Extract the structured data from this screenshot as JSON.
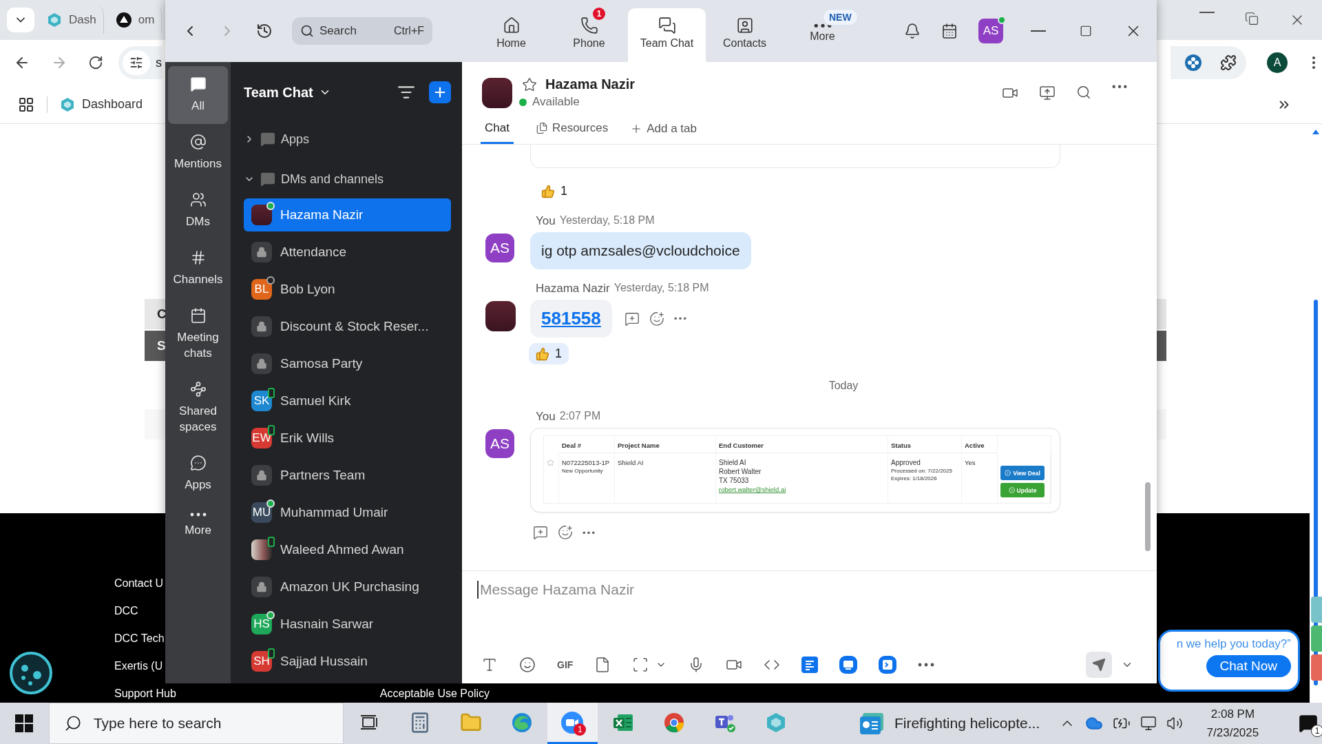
{
  "browser": {
    "tabs": [
      {
        "label": "Dash",
        "selected": false
      },
      {
        "label": "om",
        "selected": false
      }
    ],
    "address": "s",
    "profile": "A",
    "bookmarks": [
      {
        "label": "Dashboard"
      }
    ],
    "page": {
      "blocks": [
        {
          "kind": "light",
          "label": "C"
        },
        {
          "kind": "dark",
          "label": "S"
        },
        {
          "kind": "faint"
        }
      ],
      "footer_links": [
        "Contact U",
        "DCC",
        "DCC Tech",
        "Exertis (U",
        "Support Hub"
      ],
      "policy_link": "Acceptable Use Policy",
      "chat_widget": {
        "prompt": "n we help you today?”",
        "button": "Chat Now"
      }
    }
  },
  "zoom": {
    "search": {
      "placeholder": "Search",
      "shortcut": "Ctrl+F"
    },
    "nav": [
      {
        "label": "Home",
        "selected": false
      },
      {
        "label": "Phone",
        "selected": false,
        "badge": {
          "kind": "count",
          "text": "1"
        }
      },
      {
        "label": "Team Chat",
        "selected": true
      },
      {
        "label": "Contacts",
        "selected": false
      },
      {
        "label": "More",
        "selected": false,
        "badge": {
          "kind": "new",
          "text": "NEW"
        }
      }
    ],
    "profile": {
      "initials": "AS",
      "online": true
    },
    "rail": [
      {
        "label": "All",
        "selected": true
      },
      {
        "label": "Mentions",
        "selected": false
      },
      {
        "label": "DMs",
        "selected": false
      },
      {
        "label": "Channels",
        "selected": false
      },
      {
        "label": "Meeting chats",
        "selected": false
      },
      {
        "label": "Shared spaces",
        "selected": false
      },
      {
        "label": "Apps",
        "selected": false
      },
      {
        "label": "More",
        "selected": false
      }
    ],
    "list": {
      "title": "Team Chat",
      "sections": [
        {
          "label": "Apps",
          "expanded": false
        },
        {
          "label": "DMs and channels",
          "expanded": true,
          "items": [
            {
              "name": "Hazama Nazir",
              "kind": "photo",
              "online": true,
              "mobile": false,
              "selected": true
            },
            {
              "name": "Attendance",
              "kind": "channel",
              "selected": false
            },
            {
              "name": "Bob Lyon",
              "kind": "initials",
              "initials": "BL",
              "color": "#e0661c",
              "online": false,
              "mobile": false,
              "selected": false
            },
            {
              "name": "Discount & Stock Reser...",
              "kind": "channel",
              "selected": false
            },
            {
              "name": "Samosa Party",
              "kind": "channel",
              "selected": false
            },
            {
              "name": "Samuel Kirk",
              "kind": "initials",
              "initials": "SK",
              "color": "#1e88d0",
              "online": false,
              "mobile": true,
              "selected": false
            },
            {
              "name": "Erik Wills",
              "kind": "initials",
              "initials": "EW",
              "color": "#d63a32",
              "online": false,
              "mobile": true,
              "selected": false
            },
            {
              "name": "Partners Team",
              "kind": "channel",
              "selected": false
            },
            {
              "name": "Muhammad Umair",
              "kind": "initials",
              "initials": "MU",
              "color": "#3a4a5c",
              "online": true,
              "mobile": false,
              "selected": false
            },
            {
              "name": "Waleed Ahmed Awan",
              "kind": "photo",
              "online": false,
              "mobile": true,
              "selected": false
            },
            {
              "name": "Amazon UK Purchasing",
              "kind": "channel",
              "selected": false
            },
            {
              "name": "Hasnain Sarwar",
              "kind": "initials",
              "initials": "HS",
              "color": "#1fa85a",
              "online": true,
              "mobile": false,
              "selected": false
            },
            {
              "name": "Sajjad Hussain",
              "kind": "initials",
              "initials": "SH",
              "color": "#d63a32",
              "online": false,
              "mobile": true,
              "selected": false
            }
          ]
        }
      ]
    },
    "chat": {
      "name": "Hazama Nazir",
      "status": "Available",
      "starred": false,
      "tabs": [
        {
          "label": "Chat",
          "selected": true
        },
        {
          "label": "Resources",
          "selected": false
        }
      ],
      "add_tab": "Add a tab",
      "timeline": [
        {
          "kind": "reaction",
          "count": "1",
          "mine": false
        },
        {
          "kind": "message",
          "sender": "You",
          "time": "Yesterday, 5:18 PM",
          "avatar": {
            "kind": "initials",
            "initials": "AS"
          },
          "body": {
            "kind": "text",
            "text": "ig otp amzsales@vcloudchoice"
          },
          "actions_shown": false
        },
        {
          "kind": "message",
          "sender": "Hazama Nazir",
          "time": "Yesterday, 5:18 PM",
          "avatar": {
            "kind": "photo"
          },
          "body": {
            "kind": "link",
            "text": "581558"
          },
          "actions_shown": true
        },
        {
          "kind": "reaction",
          "count": "1",
          "mine": true
        },
        {
          "kind": "divider",
          "label": "Today"
        },
        {
          "kind": "message",
          "sender": "You",
          "time": "2:07 PM",
          "avatar": {
            "kind": "initials",
            "initials": "AS"
          },
          "body": {
            "kind": "card",
            "table": {
              "columns": [
                "Deal #",
                "Project Name",
                "End Customer",
                "Status",
                "Active"
              ],
              "row": {
                "starred": false,
                "deal_number": "N072225013-1P",
                "deal_type": "New Opportunity",
                "project": "Shield AI",
                "customer": [
                  "Shield AI",
                  "Robert Walter",
                  "TX 75033"
                ],
                "email": "robert.walter@shield.ai",
                "status": "Approved",
                "status_notes": [
                  "Processed on: 7/22/2025",
                  "Expires: 1/18/2026"
                ],
                "active": "Yes",
                "actions": [
                  "View Deal",
                  "Update"
                ]
              }
            }
          },
          "actions_shown": true
        }
      ],
      "compose": {
        "placeholder": "Message Hazama Nazir",
        "gif": "GIF"
      }
    }
  },
  "taskbar": {
    "search": {
      "placeholder": "Type here to search"
    },
    "apps": [
      {
        "selected": false
      },
      {
        "selected": false
      },
      {
        "selected": false
      },
      {
        "selected": false
      },
      {
        "selected": true,
        "badge": "1"
      },
      {
        "selected": false
      },
      {
        "selected": false
      },
      {
        "selected": false
      },
      {
        "selected": false
      }
    ],
    "news": "Firefighting helicopte...",
    "time": "2:08 PM",
    "date": "7/23/2025",
    "notifications": "1"
  }
}
